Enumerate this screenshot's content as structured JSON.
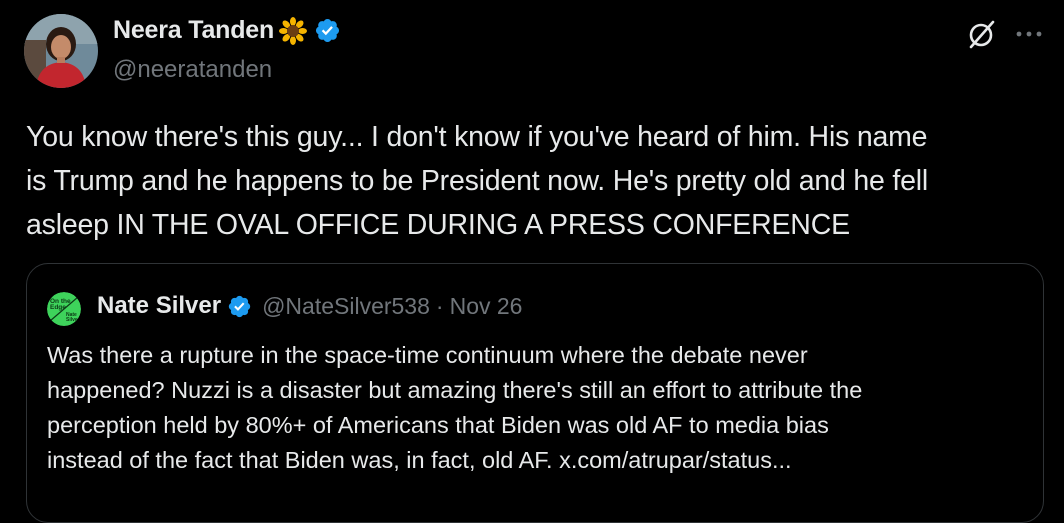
{
  "author": {
    "display_name": "Neera Tanden",
    "name_emoji": "🌻",
    "handle": "@neeratanden",
    "verified": true,
    "avatar_icon": "profile-photo"
  },
  "actions": {
    "grok_icon": "slashed-circle-icon",
    "more_icon": "ellipsis-icon"
  },
  "tweet": {
    "text": "You know there's this guy... I don't know if you've heard of him.  His name\nis Trump and he happens to be President now.  He's pretty old and he fell\nasleep IN THE OVAL OFFICE DURING A PRESS CONFERENCE"
  },
  "quoted_tweet": {
    "avatar_lines": [
      "On the",
      "Edge",
      "Nate",
      "Silver"
    ],
    "display_name": "Nate Silver",
    "verified": true,
    "handle": "@NateSilver538",
    "separator": "·",
    "date": "Nov 26",
    "text": "Was there a rupture in the space-time continuum where the debate never\nhappened? Nuzzi is a disaster but amazing there's still an effort to attribute the\nperception held by 80%+ of Americans that Biden was old AF to media bias\ninstead of the fact that Biden was, in fact, old AF. x.com/atrupar/status..."
  },
  "colors": {
    "background": "#000000",
    "primary_text": "#e7e9ea",
    "secondary_text": "#71767b",
    "border": "#2f3336",
    "verified_blue": "#1d9bf0",
    "quote_avatar_green": "#3ed35b"
  }
}
